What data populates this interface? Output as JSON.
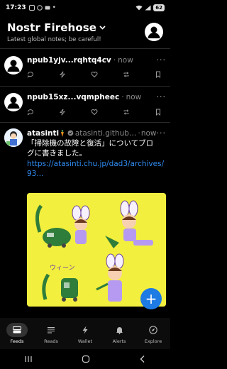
{
  "status_bar": {
    "time": "17:23",
    "battery": "62"
  },
  "header": {
    "title": "Nostr Firehose",
    "subtitle": "Latest global notes; be careful!"
  },
  "notes": [
    {
      "author": "npub1yjv...rqhtq4cv",
      "time": "now"
    },
    {
      "author": "npub15xz...vqmpheec",
      "time": "now"
    },
    {
      "author": "atasinti",
      "nip05": "atasinti.github....",
      "time": "now",
      "text_line1": "「掃除機の故障と復活」についてブロ",
      "text_line2": "グに書きました。",
      "link_line1": "https://atasinti.chu.jp/dad3/archives/",
      "link_line2": "93..."
    }
  ],
  "image_caption": "ウィーン",
  "bottom_nav": [
    {
      "label": "Feeds",
      "icon": "feeds-icon",
      "active": true
    },
    {
      "label": "Reads",
      "icon": "reads-icon"
    },
    {
      "label": "Wallet",
      "icon": "bolt-icon"
    },
    {
      "label": "Alerts",
      "icon": "bell-icon"
    },
    {
      "label": "Explore",
      "icon": "compass-icon"
    }
  ],
  "colors": {
    "accent": "#1d7be3",
    "link": "#2f8cf2",
    "background": "#000000"
  }
}
